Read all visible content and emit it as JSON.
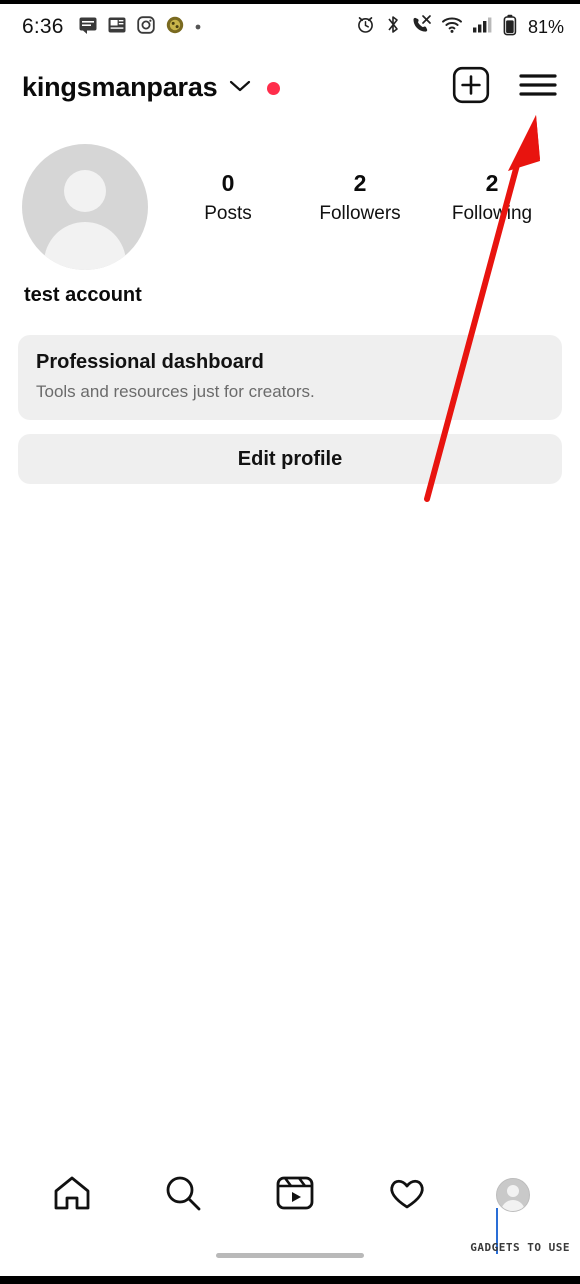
{
  "status_bar": {
    "clock": "6:36",
    "battery_percent": "81%",
    "left_icons": [
      "messages-icon",
      "news-icon",
      "instagram-icon",
      "app-icon",
      "dot-icon"
    ],
    "right_icons": [
      "alarm-icon",
      "bluetooth-icon",
      "call-mute-icon",
      "wifi-icon",
      "cellular-signal-icon",
      "battery-icon"
    ]
  },
  "header": {
    "username": "kingsmanparas",
    "chevron_icon": "chevron-down-icon",
    "notification_dot": true,
    "create_icon": "plus-square-icon",
    "menu_icon": "hamburger-menu-icon"
  },
  "profile": {
    "avatar_icon": "default-avatar-icon",
    "full_name": "test account",
    "stats": [
      {
        "value": "0",
        "label": "Posts"
      },
      {
        "value": "2",
        "label": "Followers"
      },
      {
        "value": "2",
        "label": "Following"
      }
    ]
  },
  "cards": {
    "professional_dashboard": {
      "title": "Professional dashboard",
      "subtitle": "Tools and resources just for creators."
    },
    "edit_profile_label": "Edit profile"
  },
  "annotation": {
    "arrow_color": "#e8140f",
    "points_to": "hamburger-menu-icon"
  },
  "bottom_nav": [
    {
      "name": "home",
      "icon": "home-icon"
    },
    {
      "name": "search",
      "icon": "search-icon"
    },
    {
      "name": "reels",
      "icon": "reels-icon"
    },
    {
      "name": "likes",
      "icon": "heart-icon"
    },
    {
      "name": "profile",
      "icon": "profile-avatar-icon"
    }
  ],
  "watermark": "GADGETS TO USE",
  "colors": {
    "accent_red": "#ff2d4b",
    "card_bg": "#efefef",
    "text_primary": "#0b0b0b",
    "text_muted": "#6b6b6b",
    "arrow": "#e8140f"
  }
}
